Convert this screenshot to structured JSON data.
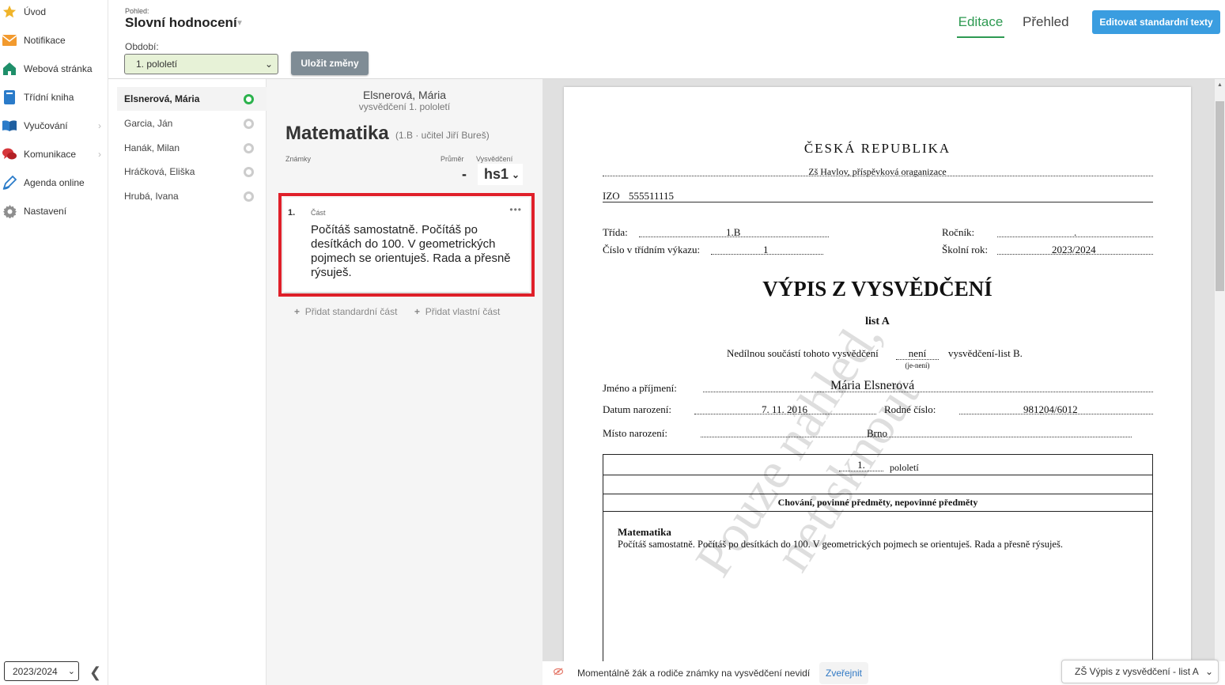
{
  "nav": {
    "items": [
      {
        "label": "Úvod",
        "icon": "star-icon"
      },
      {
        "label": "Notifikace",
        "icon": "envelope-icon"
      },
      {
        "label": "Webová stránka",
        "icon": "house-icon"
      },
      {
        "label": "Třídní kniha",
        "icon": "book-icon"
      },
      {
        "label": "Vyučování",
        "icon": "open-book-icon"
      },
      {
        "label": "Komunikace",
        "icon": "chat-icon"
      },
      {
        "label": "Agenda online",
        "icon": "pen-icon"
      },
      {
        "label": "Nastavení",
        "icon": "gear-icon"
      }
    ],
    "year": "2023/2024",
    "collapse_glyph": "❮"
  },
  "header": {
    "view_label": "Pohled:",
    "view_title": "Slovní hodnocení",
    "period_label": "Období:",
    "period_value": "1. pololetí",
    "save_label": "Uložit změny",
    "tab_edit": "Editace",
    "tab_overview": "Přehled",
    "edit_texts_label": "Editovat standardní texty"
  },
  "students": [
    {
      "name": "Elsnerová, Mária",
      "active": true
    },
    {
      "name": "Garcia, Ján",
      "active": false
    },
    {
      "name": "Hanák, Milan",
      "active": false
    },
    {
      "name": "Hráčková, Eliška",
      "active": false
    },
    {
      "name": "Hrubá, Ivana",
      "active": false
    }
  ],
  "editor": {
    "student_name": "Elsnerová, Mária",
    "subtitle": "vysvědčení 1. pololetí",
    "subject": "Matematika",
    "subject_meta": "(1.B · učitel Jiří Bureš)",
    "grades_label": "Známky",
    "avg_label": "Průměr",
    "cert_label": "Vysvědčení",
    "avg_value": "-",
    "cert_value": "hs1",
    "part": {
      "number": "1.",
      "label": "Část",
      "text": "Počítáš samostatně. Počítáš po desítkách do 100. V geometrických pojmech se orientuješ. Rada a přesně rýsuješ."
    },
    "add_standard": "Přidat standardní část",
    "add_own": "Přidat vlastní část"
  },
  "document": {
    "country": "ČESKÁ REPUBLIKA",
    "school": "Zš Havlov, příspěvková oraganizace",
    "izo_label": "IZO",
    "izo": "555511115",
    "class_label": "Třída:",
    "class_value": "1.B",
    "year_label": "Ročník:",
    "year_value": ".",
    "reg_label": "Číslo v třídním výkazu:",
    "reg_value": "1",
    "school_year_label": "Školní rok:",
    "school_year_value": "2023/2024",
    "title": "VÝPIS Z VYSVĚDČENÍ",
    "sheet": "list A",
    "integral_text": "Nedílnou součástí tohoto vysvědčení",
    "integral_value": "není",
    "integral_hint": "(je-není)",
    "integral_suffix": "vysvědčení-list B.",
    "name_label": "Jméno a příjmení:",
    "name_value": "Mária Elsnerová",
    "birth_label": "Datum narození:",
    "birth_value": "7. 11. 2016",
    "id_label": "Rodné číslo:",
    "id_value": "981204/6012",
    "place_label": "Místo narození:",
    "place_value": "Brno",
    "term_number": "1.",
    "term_label": "pololetí",
    "section_header": "Chování, povinné předměty, nepovinné předměty",
    "subject_title": "Matematika",
    "subject_text": "Počítáš samostatně. Počítáš po desítkách do 100. V geometrických pojmech se orientuješ. Rada a přesně rýsuješ.",
    "watermark_line1": "Pouze náhled,",
    "watermark_line2": "netisknout"
  },
  "footer": {
    "notice": "Momentálně žák a rodiče známky na vysvědčení nevidí",
    "publish_label": "Zveřejnit",
    "template_value": "ZŠ Výpis z vysvědčení - list A"
  },
  "colors": {
    "accent_green": "#2e9a52",
    "button_blue": "#3a9de0",
    "highlight_red": "#e0202a"
  }
}
